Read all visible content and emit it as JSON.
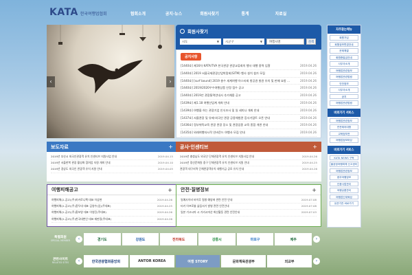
{
  "header": {
    "logo_mark": "KATA",
    "logo_text": "한국여행업협회",
    "nav": [
      "협회소개",
      "공지·뉴스",
      "회원사찾기",
      "통계",
      "자료실"
    ]
  },
  "search": {
    "title": "회원사찾기",
    "select1": "시도",
    "select2": "시군구",
    "placeholder": "여행사명",
    "button": "검색"
  },
  "notice": {
    "tab": "공지사항",
    "items": [
      {
        "title": "[1440호] 제16차 KATA/TVA 한국관광 관광교류회의 행사 대행 용역 입찰",
        "date": "2019.04.26"
      },
      {
        "title": "[1440호] 2019 서울국제관광산업박람회(SITM) 행사 설치 참가 모집",
        "date": "2019.04.26"
      },
      {
        "title": "[1440호] [surf bound] 2019 총수 세계여행 아스타회 항공권 발권 유의 및 판매 요청 공고입니다~",
        "date": "2019.04.26"
      },
      {
        "title": "[1440호] 2019/2020우수여행상품 인정 접수 공고",
        "date": "2019.04.26"
      },
      {
        "title": "[1440호] 2019년 관광통역안내사 추가채용 공고",
        "date": "2019.04.26"
      },
      {
        "title": "[1439호] 제1.18 여행산업계 개최 안내",
        "date": "2019.04.26"
      },
      {
        "title": "[1439호] 여행을 하는 관광기업 인식조사 및 일 세미나 개최 안내",
        "date": "2019.04.26"
      },
      {
        "title": "[1437호] 서울관광 및 유제-외국인 관광 공용체험관 증사기맘트 오픈 안내",
        "date": "2019.04.26"
      },
      {
        "title": "[1436호] 정부위탁교육 관광 관광 장소 및 관광업종 교육 종합 개관 안내",
        "date": "2019.04.26"
      },
      {
        "title": "[1435호] 외래여행자시작 인바운드 여행사 모집 안내",
        "date": "2019.04.26"
      }
    ]
  },
  "sidebar": {
    "group1_title": "자주찾는메뉴",
    "group1_items": [
      "회원가입",
      "회원정보변경안내",
      "문제해결",
      "회원증발급안내",
      "사무국소개",
      "여행업관련정보",
      "여행업관련법령",
      "안전정보",
      "사무국소개",
      "공지",
      "여행업관련법령"
    ],
    "group2_title": "바로가기 서비스",
    "group2_items": [
      "여행업관련정보",
      "관관제어대형",
      "교육정보관",
      "여행업정보마당"
    ],
    "group3_title": "바로가기 서비스",
    "group3_items": [
      "KATA NEWS 구독",
      "불공정여행피해 신고센터",
      "여행업관련정보",
      "중부여행정보",
      "인증사업관리",
      "여행상품관리",
      "여행업인재육성",
      "유관기관 바로가기"
    ]
  },
  "press": {
    "title": "보도자료",
    "items": [
      {
        "title": "2019년 부산시 외국인관광객 유치 인센티브 지원사업 안내",
        "date": "2019.04.15"
      },
      {
        "title": "2019년 서울한복 관광 활성화 참여업 자원 개최 안내",
        "date": "2019.04.10"
      },
      {
        "title": "2019년 경상도 외국인 관광객 유치 지원 안내",
        "date": "2019.04.05"
      }
    ]
  },
  "grants": {
    "title": "공사·인센티브",
    "items": [
      {
        "title": "2019년 충청남도 외국인 단체관광객 유치 인센티브 지원사업 안내",
        "date": "2019.04.26"
      },
      {
        "title": "2019년 정선문화원 중구 단체관광객 유치 인센티브 지원 안내",
        "date": "2019.04.25"
      },
      {
        "title": "관광객 대구지역 단체관광객유치 대행기금 공모 유치 안내",
        "date": "2019.04.26"
      }
    ]
  },
  "damage": {
    "title": "여행피해공고",
    "items": [
      {
        "title": "여행피해(2-공고)(주)마카로니팩 대표 이상현",
        "date": "2019.04.26"
      },
      {
        "title": "여행피해(2-공고)(주)풍두대 대표 김영수(업)(주대표)",
        "date": "2019.04.25"
      },
      {
        "title": "여행피해(2-공고)(주)홍보영 대표 이영진(주대표)",
        "date": "2019.04.26"
      },
      {
        "title": "여행피해(2-공고)(주)한국대변인 대표 재판정(주대표)",
        "date": "2019.04.26"
      }
    ]
  },
  "safety": {
    "title": "안전·질병정보",
    "items": [
      {
        "title": "일예사이비 바이루 질병 예방에 관련 안전 안내",
        "date": "2019.07.08"
      },
      {
        "title": "터키 아프로볼 슬립서기 발병 관련 안전안내",
        "date": "2019.07.08"
      },
      {
        "title": "일본 가고시마 시 기리시마산 화산활동 관련 안전안내",
        "date": "2019.07.03"
      }
    ]
  },
  "members": {
    "label": "특별회원",
    "sublabel": "SPECIAL MEMBER",
    "logos": [
      "경기도",
      "강원도",
      "전라북도",
      "강릉시",
      "마포구",
      "제주"
    ]
  },
  "related": {
    "label": "관련사이트",
    "sublabel": "RELATED SITES",
    "logos": [
      "한국관광협회중앙회",
      "ANTOR KOREA",
      "여행 STORY",
      "문화체육관광부",
      "외교부"
    ]
  },
  "colors": {
    "primary": "#1d5aa8",
    "notice_tab": "#e8542c",
    "press": "#3a78c3",
    "grants": "#c05a3a",
    "safety_border": "#6aab4f",
    "purple": "#6c4fa3"
  },
  "icons": {
    "search": "search-icon",
    "arrow_left": "chevron-left-icon",
    "arrow_right": "chevron-right-icon",
    "plus": "plus-icon"
  }
}
